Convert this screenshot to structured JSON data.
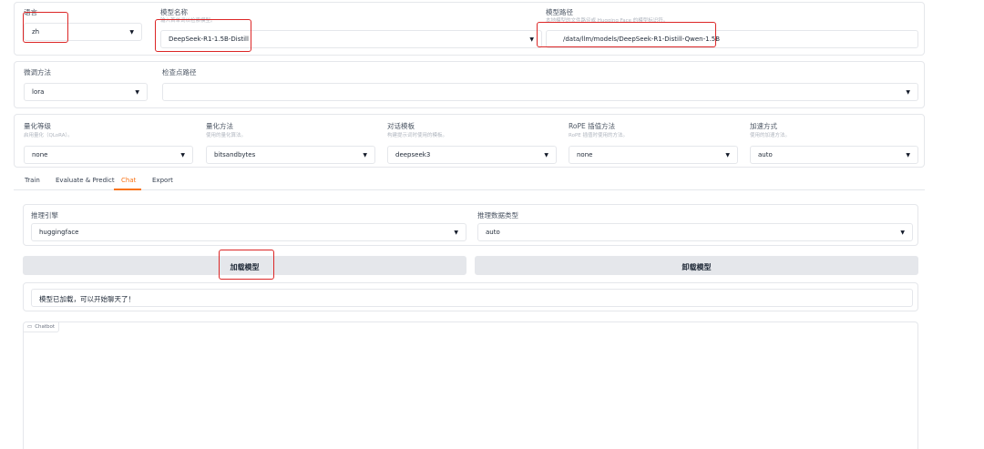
{
  "top": {
    "language": {
      "label": "语言",
      "value": "zh"
    },
    "model_name": {
      "label": "模型名称",
      "info": "输入首单词以检索模型。",
      "value": "DeepSeek-R1-1.5B-Distill"
    },
    "model_path": {
      "label": "模型路径",
      "info": "本地模型的文件路径或 Hugging Face 的模型标识符。",
      "value": "/data/llm/models/DeepSeek-R1-Distill-Qwen-1.5B"
    }
  },
  "finetune": {
    "method": {
      "label": "微调方法",
      "value": "lora"
    },
    "checkpoint": {
      "label": "检查点路径",
      "value": ""
    }
  },
  "advanced": {
    "quant_bit": {
      "label": "量化等级",
      "info": "启用量化（QLoRA）。",
      "value": "none"
    },
    "quant_method": {
      "label": "量化方法",
      "info": "使用的量化算法。",
      "value": "bitsandbytes"
    },
    "template": {
      "label": "对话模板",
      "info": "构建提示词时使用的模板。",
      "value": "deepseek3"
    },
    "rope": {
      "label": "RoPE 插值方法",
      "info": "RoPE 插值时使用的方法。",
      "value": "none"
    },
    "booster": {
      "label": "加速方式",
      "info": "使用的加速方法。",
      "value": "auto"
    }
  },
  "tabs": [
    "Train",
    "Evaluate & Predict",
    "Chat",
    "Export"
  ],
  "active_tab": "Chat",
  "chat": {
    "infer_backend": {
      "label": "推理引擎",
      "value": "huggingface"
    },
    "infer_dtype": {
      "label": "推理数据类型",
      "value": "auto"
    },
    "load_button": "加载模型",
    "unload_button": "卸载模型",
    "status": "模型已加载，可以开始聊天了！",
    "chatbot_label": "Chatbot"
  },
  "colors": {
    "accent": "#f97316",
    "highlight": "#dc2626",
    "button_bg": "#e5e7eb"
  },
  "icons": {
    "dropdown": "caret-down-icon",
    "chatbot": "chat-bubble-icon"
  }
}
